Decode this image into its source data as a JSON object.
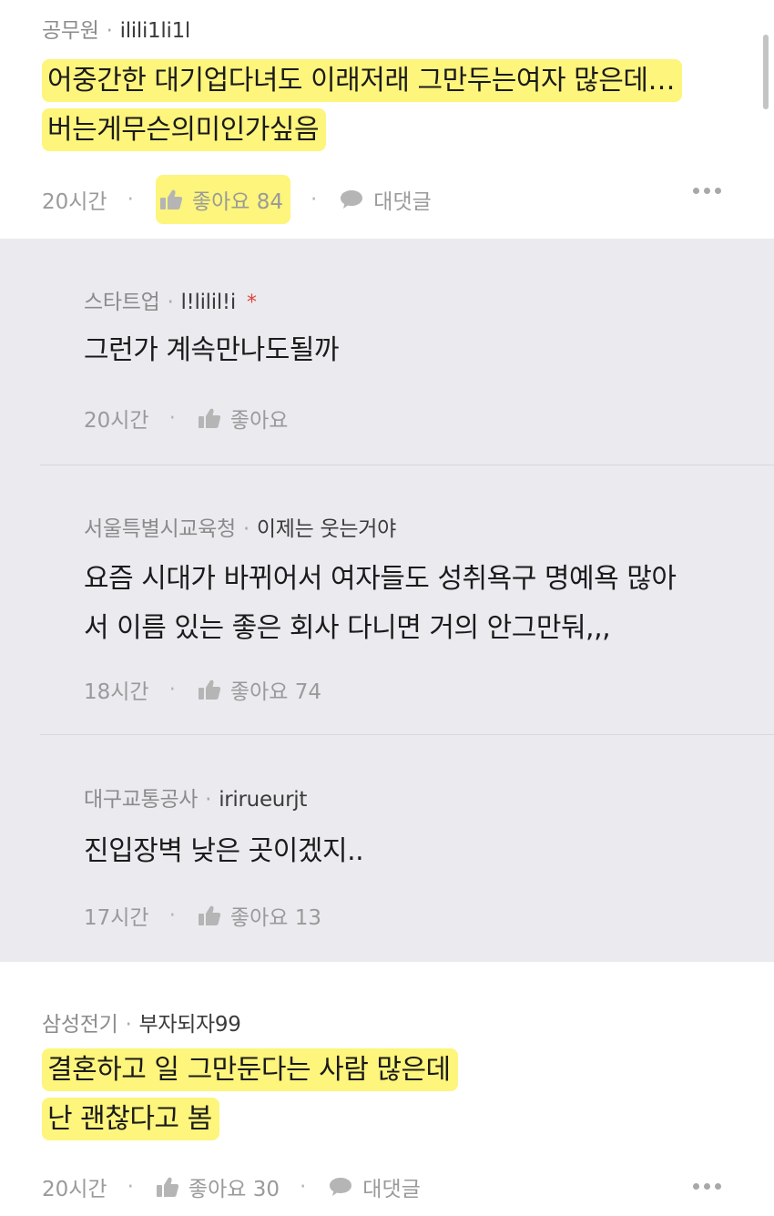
{
  "comments": [
    {
      "company": "공무원",
      "nick": "ilili1li1l",
      "lines": [
        "어중간한 대기업다녀도 이래저래 그만두는여자 많은데…",
        "버는게무슨의미인가싶음"
      ],
      "time": "20시간",
      "like_label": "좋아요 84",
      "reply_label": "대댓글"
    },
    {
      "company": "스타트업",
      "nick": "l!lilil!i",
      "author_mark": "*",
      "lines": [
        "그런가 계속만나도될까"
      ],
      "time": "20시간",
      "like_label": "좋아요"
    },
    {
      "company": "서울특별시교육청",
      "nick": "이제는 웃는거야",
      "lines": [
        "요즘 시대가 바뀌어서 여자들도 성취욕구 명예욕 많아",
        "서 이름 있는 좋은 회사 다니면 거의 안그만둬,,,"
      ],
      "time": "18시간",
      "like_label": "좋아요 74"
    },
    {
      "company": "대구교통공사",
      "nick": "irirueurjt",
      "lines": [
        "진입장벽 낮은 곳이겠지.."
      ],
      "time": "17시간",
      "like_label": "좋아요 13"
    },
    {
      "company": "삼성전기",
      "nick": "부자되자99",
      "lines": [
        "결혼하고 일 그만둔다는 사람 많은데",
        "난 괜찮다고 봄"
      ],
      "time": "20시간",
      "like_label": "좋아요 30",
      "reply_label": "대댓글"
    }
  ],
  "separator": "·",
  "colors": {
    "highlight": "#fdf57c",
    "reply_background": "#ebebef",
    "author_mark": "#e0413a"
  },
  "icons": [
    "thumbs-up-icon",
    "speech-bubble-icon",
    "more-options-icon"
  ]
}
